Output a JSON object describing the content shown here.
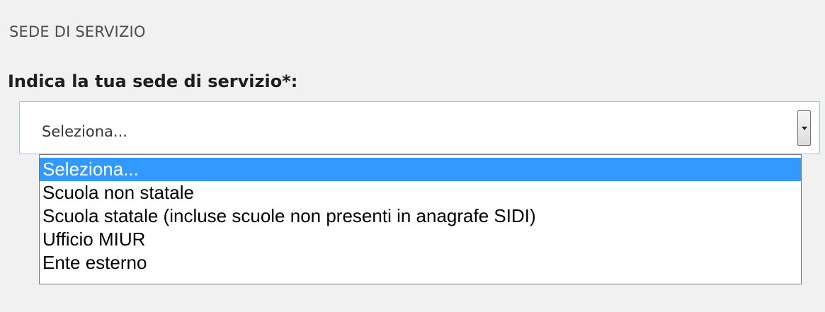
{
  "section": {
    "title": "SEDE DI SERVIZIO"
  },
  "field": {
    "label": "Indica la tua sede di servizio*:",
    "selected_value": "Seleziona...",
    "options": [
      "Seleziona...",
      "Scuola non statale",
      "Scuola statale (incluse scuole non presenti in anagrafe SIDI)",
      "Ufficio MIUR",
      "Ente esterno"
    ],
    "highlighted_option_index": 0
  },
  "colors": {
    "background": "#f1f1f1",
    "highlight": "#3399ff",
    "select_border": "#9ec3e6"
  },
  "icons": {
    "dropdown_arrow": "chevron-down-icon"
  }
}
